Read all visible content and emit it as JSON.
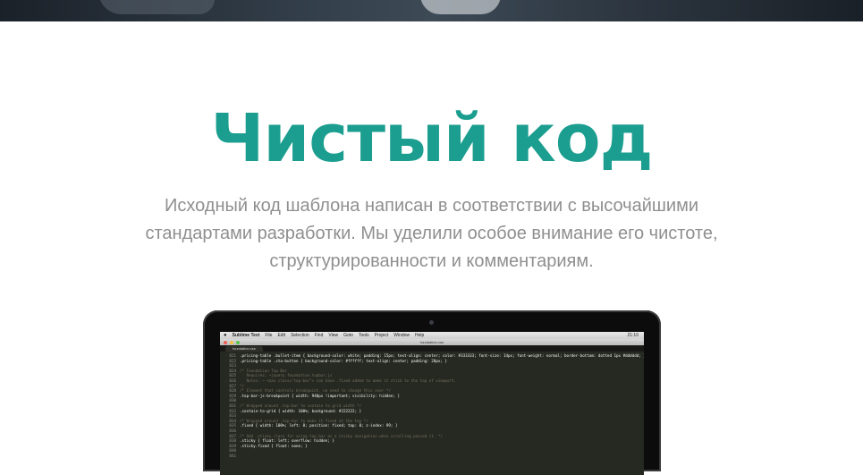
{
  "headline": "Чистый код",
  "description": {
    "lines": [
      "Исходный код шаблона написан в соответствии с высочайшими",
      "стандартами разработки. Мы уделили особое внимание его чистоте,",
      "структурированности и комментариям."
    ]
  },
  "screen": {
    "menubar": {
      "app_name": "Sublime Text",
      "items": [
        "File",
        "Edit",
        "Selection",
        "Find",
        "View",
        "Goto",
        "Tools",
        "Project",
        "Window",
        "Help"
      ],
      "clock": "21:10"
    },
    "window_title": "foundation.css",
    "tab_label": "foundation.css",
    "code_lines": [
      {
        "num": "821",
        "text": ".pricing-table .bullet-item { background-color: white; padding: 15px; text-align: center; color: #333333; font-size: 14px; font-weight: normal; border-bottom: dotted 1px #dddddd; }",
        "kind": "selector"
      },
      {
        "num": "822",
        "text": ".pricing-table .cta-button { background-color: #ffffff; text-align: center; padding: 20px; }",
        "kind": "selector"
      },
      {
        "num": "823",
        "text": "",
        "kind": "selector"
      },
      {
        "num": "824",
        "text": "/* Foundation Top Bar",
        "kind": "comment"
      },
      {
        "num": "825",
        "text": "   Requires: ~jquery.foundation.topbar.js",
        "kind": "comment"
      },
      {
        "num": "826",
        "text": "   Notes: ~ <nav class=\"top-bar\"> can have .fixed added to make it stick to the top of viewport.",
        "kind": "comment"
      },
      {
        "num": "827",
        "text": "*/",
        "kind": "comment"
      },
      {
        "num": "828",
        "text": "/* Element that controls breakpoint, no need to change this ever */",
        "kind": "comment"
      },
      {
        "num": "829",
        "text": ".top-bar-js-breakpoint { width: 940px !important; visibility: hidden; }",
        "kind": "selector"
      },
      {
        "num": "830",
        "text": "",
        "kind": "selector"
      },
      {
        "num": "831",
        "text": "/* Wrapped around .top-bar to contain to grid width */",
        "kind": "comment"
      },
      {
        "num": "832",
        "text": ".contain-to-grid { width: 100%; background: #222222; }",
        "kind": "selector"
      },
      {
        "num": "833",
        "text": "",
        "kind": "selector"
      },
      {
        "num": "834",
        "text": "/* Wrapped around .top-bar to make it fixed at the top */",
        "kind": "comment"
      },
      {
        "num": "835",
        "text": ".fixed { width: 100%; left: 0; position: fixed; top: 0; z-index: 99; }",
        "kind": "selector"
      },
      {
        "num": "836",
        "text": "",
        "kind": "selector"
      },
      {
        "num": "837",
        "text": "/* Add .sticky class for using top bar as a sticky navigation when scrolling passed it. */",
        "kind": "comment"
      },
      {
        "num": "838",
        "text": ".sticky { float: left; overflow: hidden; }",
        "kind": "selector"
      },
      {
        "num": "839",
        "text": ".sticky.fixed { float: none; }",
        "kind": "selector"
      },
      {
        "num": "840",
        "text": "",
        "kind": "selector"
      },
      {
        "num": "841",
        "text": "",
        "kind": "selector"
      }
    ]
  },
  "colors": {
    "accent": "#1b9e8f",
    "body_text": "#8f8f8f",
    "editor_background": "#262822"
  }
}
